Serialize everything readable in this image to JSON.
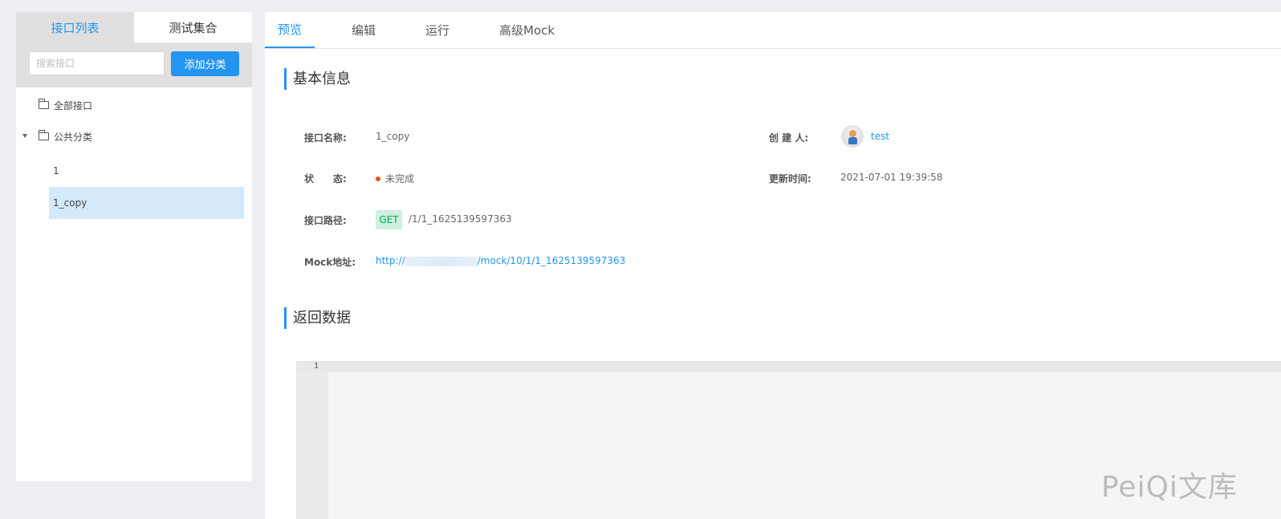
{
  "sidebar": {
    "tabs": [
      {
        "label": "接口列表"
      },
      {
        "label": "测试集合"
      }
    ],
    "search_placeholder": "搜索接口",
    "add_category_label": "添加分类",
    "tree": {
      "all_label": "全部接口",
      "category_label": "公共分类",
      "items": [
        {
          "label": "1"
        },
        {
          "label": "1_copy"
        }
      ]
    }
  },
  "main": {
    "tabs": [
      {
        "label": "预览"
      },
      {
        "label": "编辑"
      },
      {
        "label": "运行"
      },
      {
        "label": "高级Mock"
      }
    ],
    "basic_info": {
      "title": "基本信息",
      "name_label": "接口名称:",
      "name_value": "1_copy",
      "creator_label": "创 建 人:",
      "creator_value": "test",
      "status_label": "状　　态:",
      "status_value": "未完成",
      "updated_label": "更新时间:",
      "updated_value": "2021-07-01 19:39:58",
      "path_label": "接口路径:",
      "method": "GET",
      "path_value": "/1/1_1625139597363",
      "mock_label": "Mock地址:",
      "mock_prefix": "http://",
      "mock_suffix": "/mock/10/1/1_1625139597363"
    },
    "return_data": {
      "title": "返回数据",
      "line_number": "1"
    }
  },
  "watermark": "PeiQi文库",
  "colors": {
    "accent": "#2395f1",
    "status_dot": "#e6541d",
    "method_bg": "#cfefdf",
    "method_text": "#00a854",
    "selected_row": "#d4e9fa"
  }
}
